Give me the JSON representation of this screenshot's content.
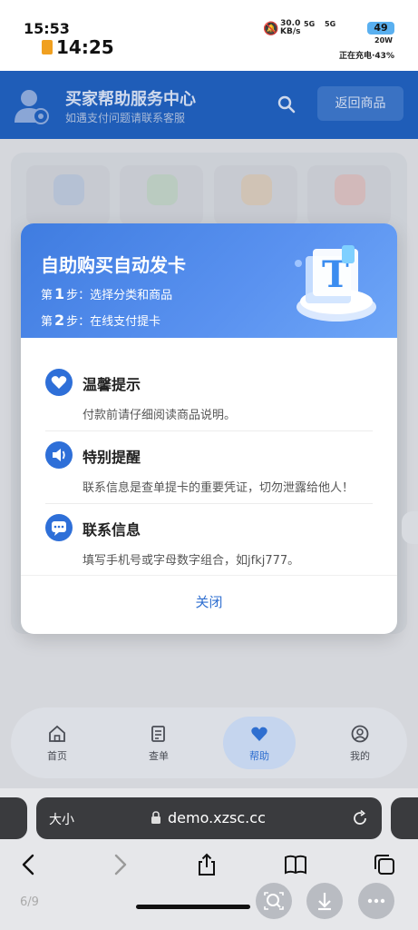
{
  "status_bar": {
    "time_small": "15:53",
    "time_big": "14:25",
    "network_speed_value": "30.0",
    "network_speed_unit": "KB/s",
    "signal1": "5G",
    "signal2": "5G",
    "battery": "49",
    "charge_watt": "20W",
    "charging_text": "正在充电·43%"
  },
  "header": {
    "title": "买家帮助服务中心",
    "subtitle": "如遇支付问题请联系客服",
    "back_label": "返回商品"
  },
  "modal": {
    "title": "自助购买自动发卡",
    "steps": [
      {
        "prefix": "第",
        "num": "1",
        "suffix": "步：选择分类和商品"
      },
      {
        "prefix": "第",
        "num": "2",
        "suffix": "步：在线支付提卡"
      }
    ],
    "tips": [
      {
        "title": "温馨提示",
        "text": "付款前请仔细阅读商品说明。",
        "icon": "heart-icon"
      },
      {
        "title": "特别提醒",
        "text": "联系信息是查单提卡的重要凭证，切勿泄露给他人！",
        "icon": "speaker-icon"
      },
      {
        "title": "联系信息",
        "text": "填写手机号或字母数字组合，如jfkj777。",
        "icon": "chat-icon"
      }
    ],
    "close_label": "关闭"
  },
  "bottom_nav": [
    {
      "label": "首页",
      "icon": "home-icon",
      "active": false
    },
    {
      "label": "查单",
      "icon": "receipt-icon",
      "active": false
    },
    {
      "label": "帮助",
      "icon": "heart-icon",
      "active": true
    },
    {
      "label": "我的",
      "icon": "user-icon",
      "active": false
    }
  ],
  "browser": {
    "text_size": "大小",
    "url": "demo.xzsc.cc",
    "page_counter": "6/9"
  },
  "colors": {
    "brand": "#1f5db8",
    "accent": "#2f6fd0",
    "modal_header": "#4a86e8"
  }
}
